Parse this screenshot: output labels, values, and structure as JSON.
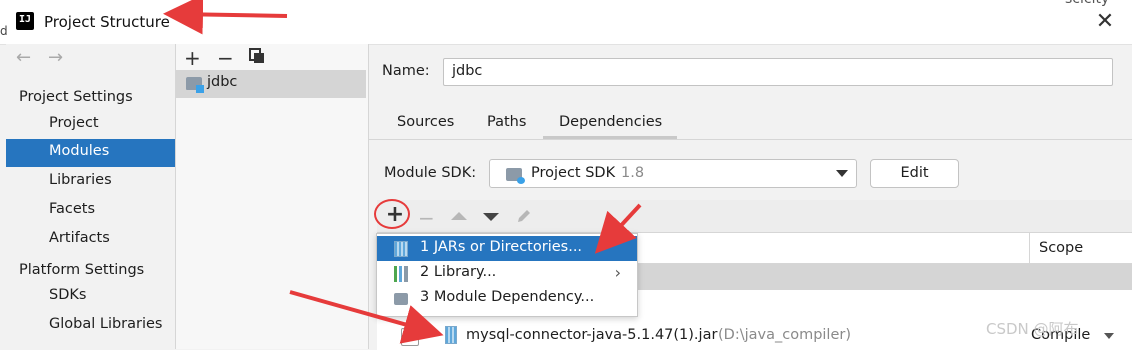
{
  "window": {
    "title": "Project Structure",
    "background_fragment": "scicity",
    "background_left_char": "d"
  },
  "navigation": {
    "back": "←",
    "forward": "→"
  },
  "settings": {
    "project_settings_label": "Project Settings",
    "project_items": [
      "Project",
      "Modules",
      "Libraries",
      "Facets",
      "Artifacts"
    ],
    "selected": "Modules",
    "platform_settings_label": "Platform Settings",
    "platform_items": [
      "SDKs",
      "Global Libraries"
    ]
  },
  "module_toolbar": {
    "add": "+",
    "remove": "−",
    "copy_icon": "copy-icon"
  },
  "modules": [
    {
      "name": "jdbc"
    }
  ],
  "details": {
    "name_label": "Name:",
    "name_value": "jdbc",
    "tabs": [
      "Sources",
      "Paths",
      "Dependencies"
    ],
    "active_tab": "Dependencies",
    "sdk_label": "Module SDK:",
    "sdk_value": "Project SDK",
    "sdk_version": "1.8",
    "edit_button": "Edit"
  },
  "dependencies": {
    "toolbar": {
      "add": "+",
      "remove": "−",
      "up_icon": "move-up-icon",
      "down_icon": "move-down-icon",
      "edit_icon": "pencil-icon"
    },
    "scope_header": "Scope",
    "popup": [
      {
        "label": "1  JARs or Directories...",
        "icon": "jar-icon",
        "highlighted": true
      },
      {
        "label": "2  Library...",
        "icon": "library-icon",
        "submenu": true
      },
      {
        "label": "3  Module Dependency...",
        "icon": "module-icon"
      }
    ],
    "rows": [
      {
        "name": "mysql-connector-java-5.1.47(1).jar",
        "path": "(D:\\java_compiler)",
        "scope": "Compile",
        "checked": false
      }
    ]
  },
  "watermark": "CSDN @阿布",
  "colors": {
    "selection": "#2675bf",
    "annotation_red": "#e63b3b"
  }
}
